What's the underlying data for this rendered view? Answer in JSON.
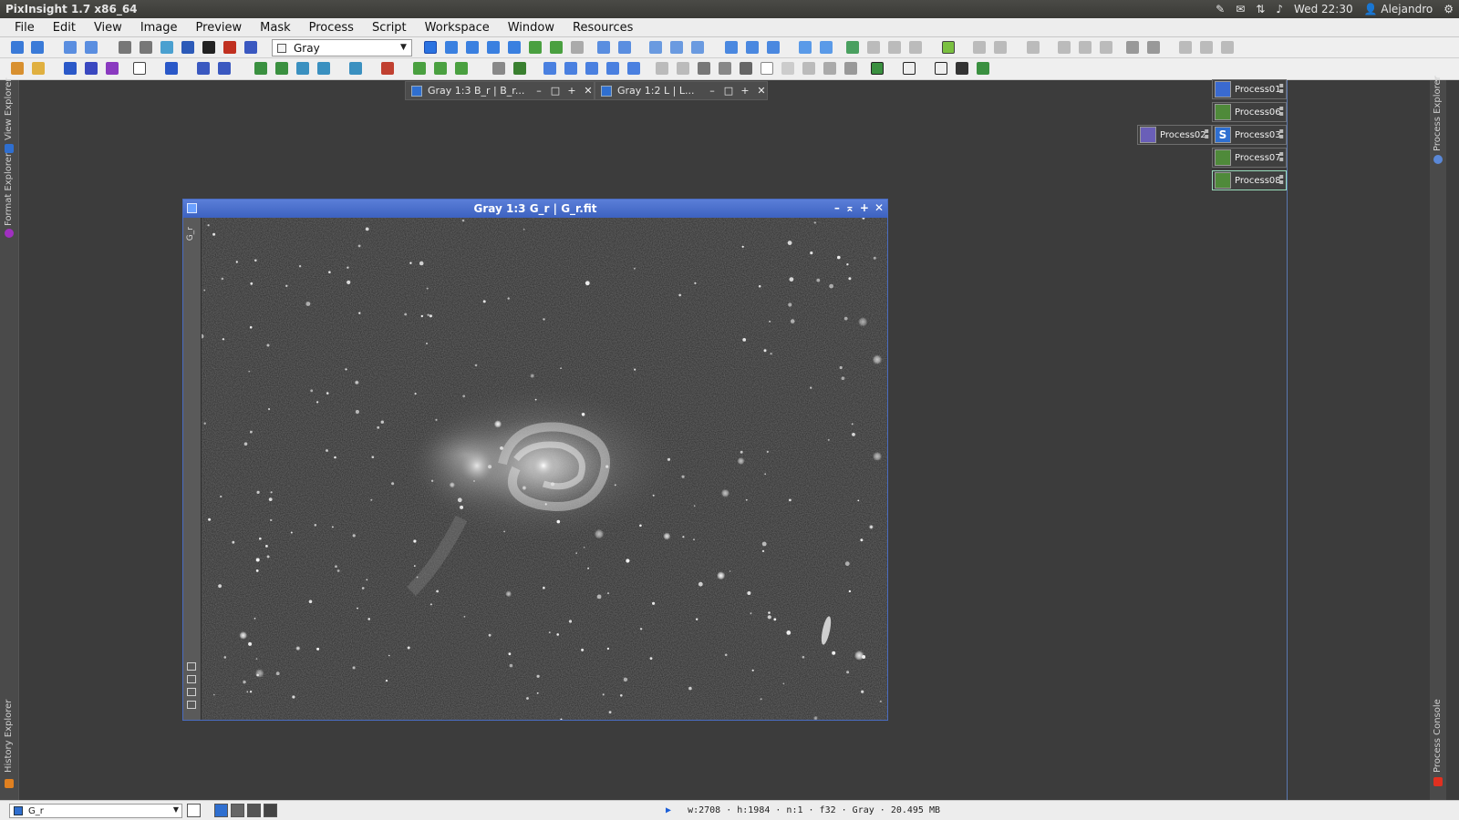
{
  "os_panel": {
    "app_title": "PixInsight 1.7 x86_64",
    "clock": "Wed 22:30",
    "user": "Alejandro"
  },
  "menu": {
    "items": [
      "File",
      "Edit",
      "View",
      "Image",
      "Preview",
      "Mask",
      "Process",
      "Script",
      "Workspace",
      "Window",
      "Resources"
    ]
  },
  "toolbar": {
    "color_space_value": "Gray"
  },
  "side_panels": {
    "left_top": [
      "View Explorer",
      "Format Explorer"
    ],
    "left_bottom": "History Explorer",
    "right_top": "Process Explorer",
    "right_bottom": "Process Console"
  },
  "iconized_windows": [
    {
      "label": "Gray 1:3 B_r | B_r..."
    },
    {
      "label": "Gray 1:2 L | L..."
    }
  ],
  "process_icons": [
    {
      "label": "Process01",
      "color": "#3a6ad0"
    },
    {
      "label": "Process06",
      "color": "#4f8a3a"
    },
    {
      "label": "Process02",
      "color": "#6a5fb8"
    },
    {
      "label": "Process03",
      "color": "#2f6fd0"
    },
    {
      "label": "Process07",
      "color": "#4f8a3a"
    },
    {
      "label": "Process08",
      "color": "#4f8a3a"
    }
  ],
  "image_window": {
    "title": "Gray 1:3 G_r | G_r.fit",
    "sidebar_label": "G_r"
  },
  "statusbar": {
    "view_id": "G_r",
    "info": "w:2708 · h:1984 · n:1 · f32 · Gray · 20.495 MB"
  },
  "colors": {
    "accent": "#3d62c0",
    "window_bg": "#3c3c3c",
    "menubar_bg": "#ededed"
  }
}
